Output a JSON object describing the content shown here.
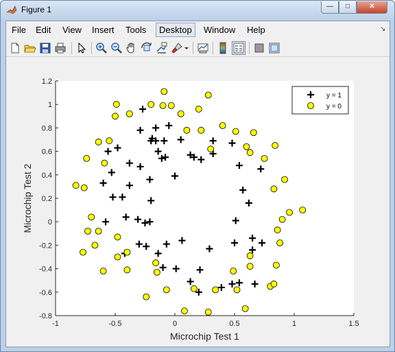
{
  "window": {
    "title": "Figure 1"
  },
  "menu": [
    "File",
    "Edit",
    "View",
    "Insert",
    "Tools",
    "Desktop",
    "Window",
    "Help"
  ],
  "active_menu": "Desktop",
  "toolbar": [
    "new-figure-icon",
    "open-file-icon",
    "save-icon",
    "print-icon",
    "edit-plot-arrow-icon",
    "zoom-in-icon",
    "zoom-out-icon",
    "pan-hand-icon",
    "rotate-3d-icon",
    "data-cursor-icon",
    "brush-icon",
    "brush-dropdown-icon",
    "link-plot-icon",
    "colorbar-icon",
    "legend-icon",
    "hide-plot-tools-icon",
    "show-plot-tools-icon"
  ],
  "colors": {
    "y0_face": "#ffff00",
    "y1_marker": "#000000",
    "axes_bg": "#ffffff",
    "figure_bg": "#f0f0f0"
  },
  "chart_data": {
    "type": "scatter",
    "xlabel": "Microchip Test 1",
    "ylabel": "Microchip Test 2",
    "xlim": [
      -1,
      1.5
    ],
    "ylim": [
      -0.8,
      1.2
    ],
    "xticks": [
      "-1",
      "-0.5",
      "0",
      "0.5",
      "1",
      "1.5"
    ],
    "yticks": [
      "-0.8",
      "-0.6",
      "-0.4",
      "-0.2",
      "0",
      "0.2",
      "0.4",
      "0.6",
      "0.8",
      "1",
      "1.2"
    ],
    "grid": false,
    "legend": {
      "position": "top-right",
      "entries": [
        "y = 1",
        "y = 0"
      ]
    },
    "series": [
      {
        "name": "y = 1",
        "marker": "plus",
        "points": [
          [
            -0.27,
            0.96
          ],
          [
            -0.29,
            0.78
          ],
          [
            -0.16,
            0.8
          ],
          [
            -0.05,
            0.82
          ],
          [
            -0.2,
            0.69
          ],
          [
            -0.19,
            0.71
          ],
          [
            -0.16,
            0.69
          ],
          [
            -0.09,
            0.69
          ],
          [
            -0.14,
            0.6
          ],
          [
            -0.11,
            0.54
          ],
          [
            -0.08,
            0.55
          ],
          [
            0.05,
            0.7
          ],
          [
            0.13,
            0.57
          ],
          [
            0.16,
            0.55
          ],
          [
            0.22,
            0.53
          ],
          [
            0.32,
            0.69
          ],
          [
            0.32,
            0.58
          ],
          [
            -0.56,
            0.6
          ],
          [
            -0.48,
            0.63
          ],
          [
            -0.53,
            0.42
          ],
          [
            -0.38,
            0.5
          ],
          [
            -0.38,
            0.31
          ],
          [
            -0.29,
            0.47
          ],
          [
            -0.21,
            0.36
          ],
          [
            -0.2,
            0.18
          ],
          [
            -0.6,
            0.33
          ],
          [
            -0.52,
            0.21
          ],
          [
            -0.44,
            0.21
          ],
          [
            0.0,
            0.39
          ],
          [
            0.54,
            0.48
          ],
          [
            0.57,
            0.27
          ],
          [
            0.62,
            0.16
          ],
          [
            0.72,
            0.45
          ],
          [
            0.48,
            0.67
          ],
          [
            -0.58,
            0.0
          ],
          [
            -0.41,
            0.04
          ],
          [
            -0.31,
            0.02
          ],
          [
            -0.25,
            -0.01
          ],
          [
            -0.21,
            0.0
          ],
          [
            -0.3,
            -0.19
          ],
          [
            -0.24,
            -0.21
          ],
          [
            -0.07,
            -0.19
          ],
          [
            0.06,
            -0.16
          ],
          [
            -0.14,
            -0.27
          ],
          [
            -0.1,
            -0.39
          ],
          [
            -0.42,
            -0.27
          ],
          [
            0.01,
            -0.4
          ],
          [
            0.13,
            -0.51
          ],
          [
            0.21,
            -0.41
          ],
          [
            0.2,
            -0.6
          ],
          [
            0.29,
            -0.23
          ],
          [
            0.39,
            -0.56
          ],
          [
            0.48,
            -0.53
          ],
          [
            0.54,
            -0.52
          ],
          [
            0.51,
            0.01
          ],
          [
            0.5,
            -0.18
          ],
          [
            0.65,
            -0.14
          ],
          [
            0.65,
            -0.24
          ],
          [
            0.73,
            -0.18
          ],
          [
            0.67,
            -0.53
          ]
        ]
      },
      {
        "name": "y = 0",
        "marker": "circle",
        "points": [
          [
            -0.49,
            1.0
          ],
          [
            -0.38,
            0.92
          ],
          [
            -0.5,
            0.9
          ],
          [
            -0.2,
            1.0
          ],
          [
            -0.09,
            1.11
          ],
          [
            -0.1,
            0.99
          ],
          [
            -0.03,
            0.99
          ],
          [
            0.05,
            0.92
          ],
          [
            0.28,
            1.08
          ],
          [
            0.2,
            0.96
          ],
          [
            0.1,
            0.78
          ],
          [
            0.22,
            0.78
          ],
          [
            0.4,
            0.82
          ],
          [
            0.51,
            0.77
          ],
          [
            0.66,
            0.76
          ],
          [
            0.6,
            0.64
          ],
          [
            0.63,
            0.59
          ],
          [
            0.75,
            0.54
          ],
          [
            0.84,
            0.65
          ],
          [
            0.3,
            0.62
          ],
          [
            -0.55,
            0.69
          ],
          [
            -0.64,
            0.68
          ],
          [
            -0.74,
            0.54
          ],
          [
            -0.59,
            0.5
          ],
          [
            -0.76,
            0.29
          ],
          [
            -0.83,
            0.31
          ],
          [
            -0.7,
            0.04
          ],
          [
            -0.73,
            -0.08
          ],
          [
            -0.64,
            -0.08
          ],
          [
            -0.77,
            -0.26
          ],
          [
            -0.67,
            -0.2
          ],
          [
            -0.6,
            -0.42
          ],
          [
            -0.48,
            -0.3
          ],
          [
            -0.4,
            -0.26
          ],
          [
            -0.48,
            -0.13
          ],
          [
            -0.4,
            -0.41
          ],
          [
            -0.16,
            -0.35
          ],
          [
            -0.15,
            -0.43
          ],
          [
            -0.07,
            -0.58
          ],
          [
            -0.24,
            -0.64
          ],
          [
            0.16,
            -0.57
          ],
          [
            0.34,
            -0.58
          ],
          [
            0.49,
            -0.42
          ],
          [
            0.52,
            -0.58
          ],
          [
            0.28,
            -0.77
          ],
          [
            0.08,
            -0.76
          ],
          [
            0.59,
            -0.74
          ],
          [
            0.63,
            -0.29
          ],
          [
            0.63,
            -0.38
          ],
          [
            0.8,
            -0.55
          ],
          [
            0.83,
            -0.53
          ],
          [
            0.85,
            -0.37
          ],
          [
            0.86,
            -0.07
          ],
          [
            0.88,
            -0.18
          ],
          [
            0.9,
            0.02
          ],
          [
            0.96,
            0.08
          ],
          [
            1.07,
            0.1
          ],
          [
            0.92,
            0.36
          ],
          [
            0.83,
            0.28
          ]
        ]
      }
    ]
  }
}
